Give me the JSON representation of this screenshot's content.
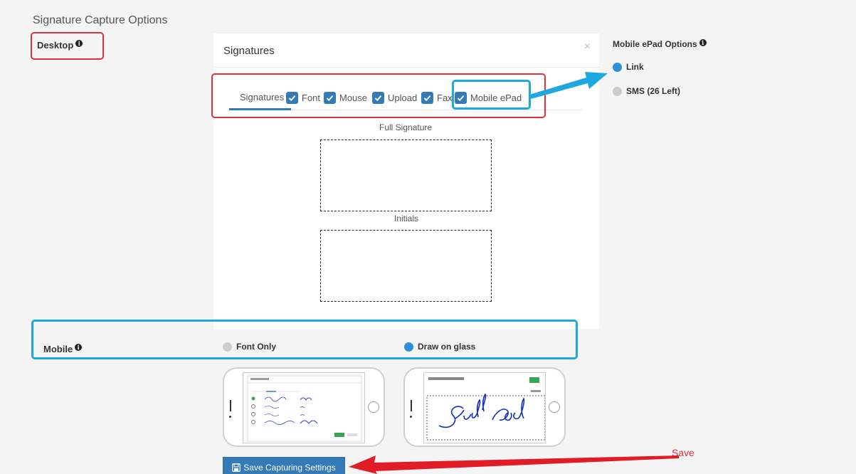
{
  "page": {
    "title": "Signature Capture Options"
  },
  "desktop": {
    "label": "Desktop",
    "info_icon": "info-circle-icon"
  },
  "mobile_epad": {
    "label": "Mobile ePad Options",
    "info_icon": "info-circle-icon",
    "options": [
      {
        "label": "Link",
        "selected": true
      },
      {
        "label": "SMS (26 Left)",
        "selected": false
      }
    ]
  },
  "modal": {
    "title": "Signatures",
    "close_glyph": "×",
    "tabs": [
      {
        "label": "Signatures",
        "checked": null,
        "active": true
      },
      {
        "label": "Font",
        "checked": true
      },
      {
        "label": "Mouse",
        "checked": true
      },
      {
        "label": "Upload",
        "checked": true
      },
      {
        "label": "Fax",
        "checked": true
      },
      {
        "label": "Mobile ePad",
        "checked": true
      }
    ],
    "full_signature_label": "Full Signature",
    "initials_label": "Initials"
  },
  "mobile": {
    "label": "Mobile",
    "info_icon": "info-circle-icon",
    "options": [
      {
        "label": "Font Only",
        "selected": false
      },
      {
        "label": "Draw on glass",
        "selected": true
      }
    ]
  },
  "save_button": {
    "label": "Save Capturing Settings",
    "icon": "floppy-disk-icon"
  },
  "annotations": {
    "save_label": "Save"
  },
  "colors": {
    "accent": "#337ab7",
    "red_highlight": "#e0313b",
    "blue_highlight": "#1da8e0"
  }
}
